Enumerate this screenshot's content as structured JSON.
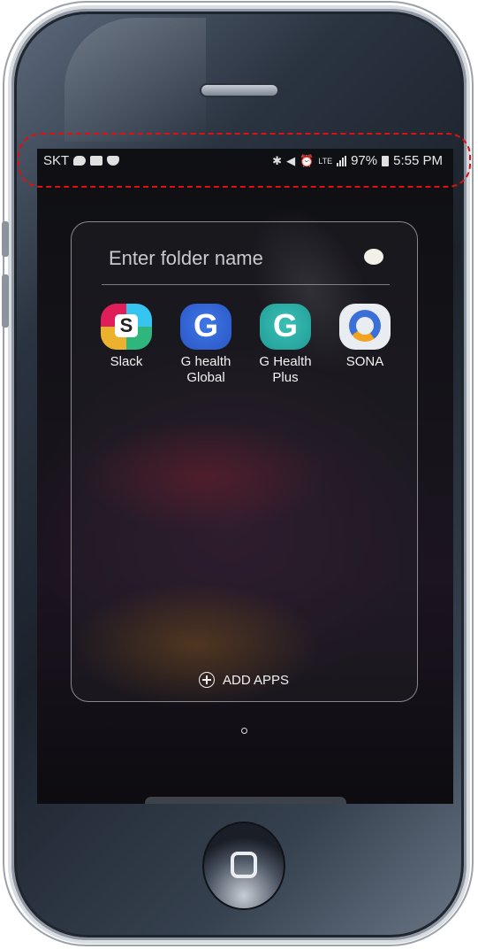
{
  "status_bar": {
    "carrier": "SKT",
    "left_icons": [
      "talk-icon",
      "gallery-icon",
      "en-shield-icon"
    ],
    "right_icons": [
      "bluetooth-icon",
      "mute-icon",
      "alarm-icon",
      "lte-icon",
      "signal-icon"
    ],
    "lte_label": "LTE",
    "battery": "97%",
    "time": "5:55 PM"
  },
  "folder": {
    "name_placeholder": "Enter folder name",
    "apps": [
      {
        "label": "Slack",
        "icon": "slack-icon",
        "glyph": "S"
      },
      {
        "label": "G health\nGlobal",
        "icon": "g-health-global-icon",
        "glyph": "G"
      },
      {
        "label": "G Health\nPlus",
        "icon": "g-health-plus-icon",
        "glyph": "G"
      },
      {
        "label": "SONA",
        "icon": "sona-icon"
      }
    ],
    "add_apps_label": "ADD APPS"
  },
  "colors": {
    "highlight_outline": "#e01010",
    "folder_border": "#e6e6e6"
  }
}
